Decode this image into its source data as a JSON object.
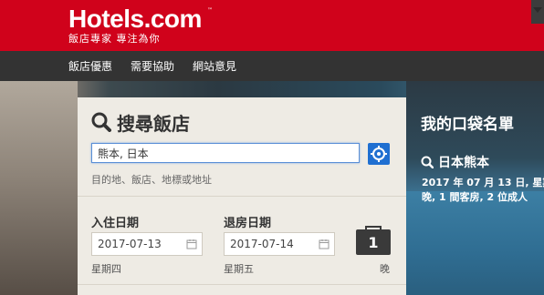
{
  "header": {
    "logo_text": "Hotels.com",
    "logo_tm": "™",
    "tagline": "飯店專家 專注為你",
    "brand_color": "#d0021b"
  },
  "nav": {
    "items": [
      {
        "label": "飯店優惠"
      },
      {
        "label": "需要協助"
      },
      {
        "label": "網站意見"
      }
    ]
  },
  "search": {
    "title": "搜尋飯店",
    "destination_value": "熊本, 日本",
    "destination_hint": "目的地、飯店、地標或地址",
    "checkin_label": "入住日期",
    "checkout_label": "退房日期",
    "checkin_value": "2017-07-13",
    "checkout_value": "2017-07-14",
    "checkin_weekday": "星期四",
    "checkout_weekday": "星期五",
    "nights_value": "1",
    "nights_label": "晚"
  },
  "wishlist": {
    "title": "我的口袋名單",
    "item_title": "日本熊本",
    "item_detail_line1": "2017 年 07 月 13 日, 星期",
    "item_detail_line2": "晚, 1 間客房, 2 位成人"
  },
  "icons": [
    "search-icon",
    "locate-icon",
    "calendar-icon",
    "suitcase-icon",
    "dropdown-arrow-icon"
  ]
}
